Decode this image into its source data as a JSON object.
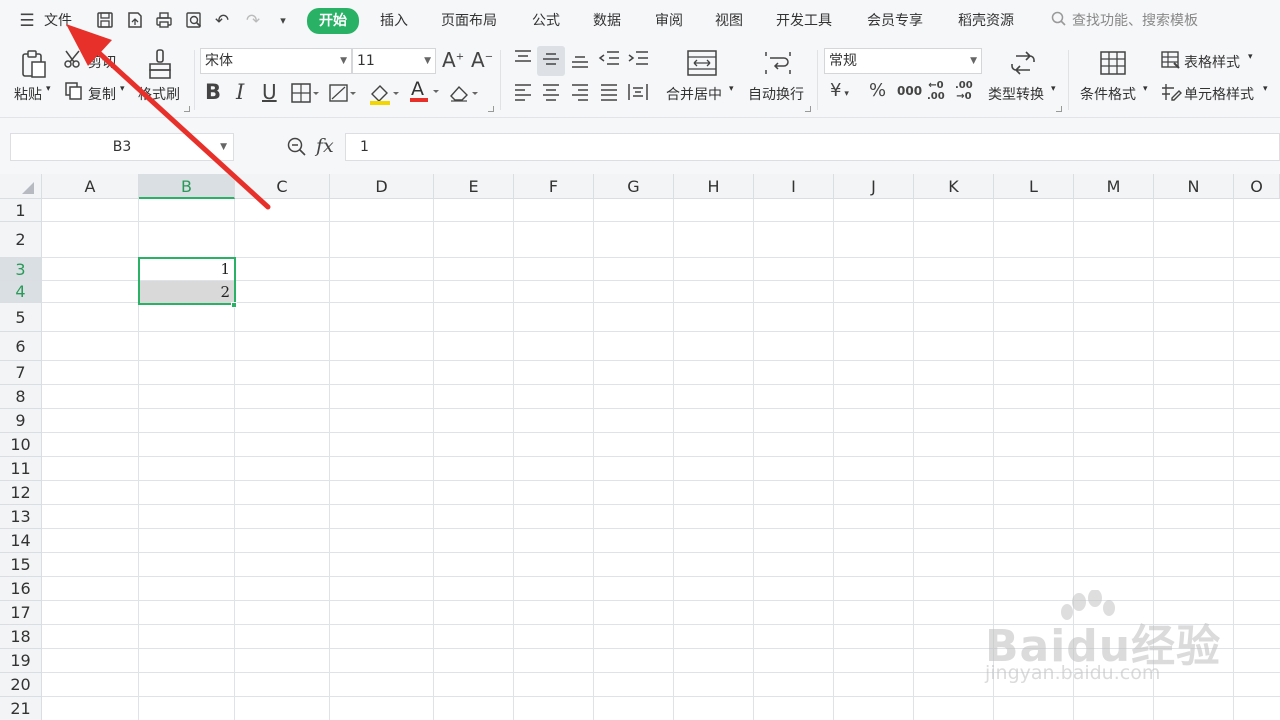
{
  "menubar": {
    "file": "文件",
    "tabs": [
      "开始",
      "插入",
      "页面布局",
      "公式",
      "数据",
      "审阅",
      "视图",
      "开发工具",
      "会员专享",
      "稻壳资源"
    ],
    "active_tab": "开始",
    "search_placeholder": "查找功能、搜索模板"
  },
  "ribbon": {
    "paste": "粘贴",
    "cut": "剪切",
    "copy": "复制",
    "format_painter": "格式刷",
    "font_name": "宋体",
    "font_size": "11",
    "merge_center": "合并居中",
    "wrap_text": "自动换行",
    "number_format": "常规",
    "type_convert": "类型转换",
    "conditional_format": "条件格式",
    "table_style": "表格样式",
    "cell_style": "单元格样式",
    "currency_symbol": "¥",
    "percent_symbol": "%",
    "thousands_symbol": "000",
    "increase_decimal": ".00",
    "decrease_decimal": ".00"
  },
  "formula_bar": {
    "name_box": "B3",
    "fx": "fx",
    "value": "1"
  },
  "sheet": {
    "columns": [
      "A",
      "B",
      "C",
      "D",
      "E",
      "F",
      "G",
      "H",
      "I",
      "J",
      "K",
      "L",
      "M",
      "N",
      "O"
    ],
    "rows": [
      "1",
      "2",
      "3",
      "4",
      "5",
      "6",
      "7",
      "8",
      "9",
      "10",
      "11",
      "12",
      "13",
      "14",
      "15",
      "16",
      "17",
      "18",
      "19",
      "20",
      "21"
    ],
    "selected_column": "B",
    "selected_rows": [
      "3",
      "4"
    ],
    "cells": {
      "B3": "1",
      "B4": "2"
    }
  },
  "colors": {
    "accent": "#29b266",
    "arrow": "#e8302a"
  },
  "watermark": {
    "brand": "Baidu经验",
    "url": "jingyan.baidu.com"
  }
}
